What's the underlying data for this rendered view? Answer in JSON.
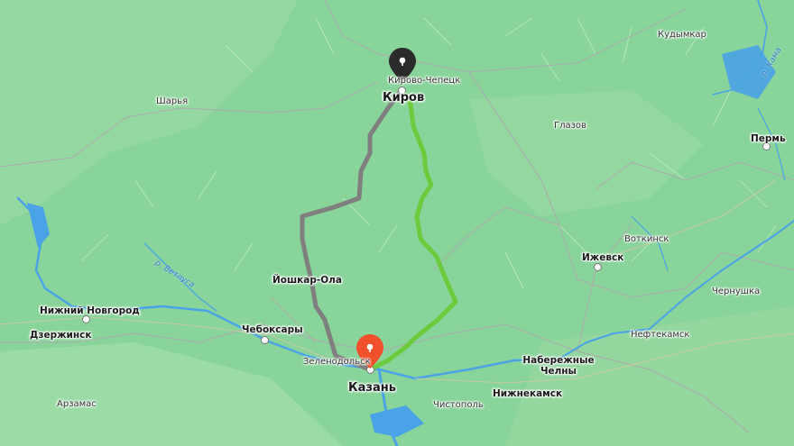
{
  "map": {
    "colors": {
      "land": "#88d49a",
      "land_light": "#a3dfa8",
      "water": "#4aa3e6",
      "route_main": "#6ccb3c",
      "route_alt": "#7f7f7f",
      "boundary": "#a8b0a8",
      "start_pin": "#2b2b2b",
      "end_pin": "#f0502a"
    },
    "route": {
      "start_city": "Киров",
      "end_city": "Казань",
      "start_pin_icon": "map-pin-icon",
      "end_pin_icon": "map-pin-icon"
    },
    "cities": {
      "kirov": "Киров",
      "kazan": "Казань",
      "kirovo_chepetsk": "Кирово-Чепецк",
      "kudymkar": "Кудымкар",
      "sharya": "Шарья",
      "glazov": "Глазов",
      "perm": "Пермь",
      "votkinsk": "Воткинск",
      "izhevsk": "Ижевск",
      "yoshkar_ola": "Йошкар-Ола",
      "nizhny_novgorod": "Нижний Новгород",
      "dzerzhinsk": "Дзержинск",
      "cheboksary": "Чебоксары",
      "chernushka": "Чернушка",
      "neftekamsk": "Нефтекамск",
      "naberezhnye_chelny": "Набережные Челны",
      "nizhnekamsk": "Нижнекамск",
      "zelenodolsk": "Зеленодольск",
      "chistopol": "Чистополь",
      "arzamas": "Арзамас"
    },
    "rivers": {
      "vetluga": "р. Ветлуга",
      "kama": "р. Кама"
    }
  }
}
